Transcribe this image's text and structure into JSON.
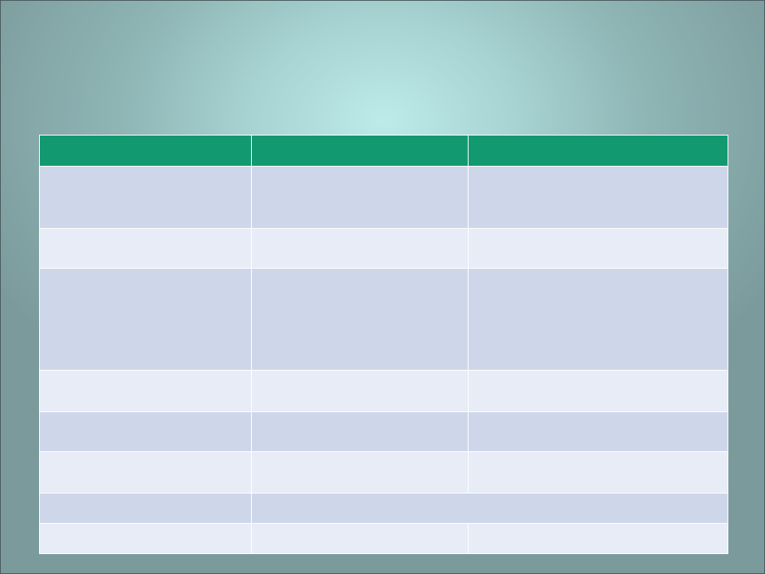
{
  "colors": {
    "header": "#12996f",
    "row_dark": "#ced7ea",
    "row_light": "#e8ecf6"
  },
  "table": {
    "headers": [
      "",
      "",
      ""
    ],
    "rows": [
      [
        "",
        "",
        ""
      ],
      [
        "",
        "",
        ""
      ],
      [
        "",
        "",
        ""
      ],
      [
        "",
        "",
        ""
      ],
      [
        "",
        "",
        ""
      ],
      [
        "",
        "",
        ""
      ],
      [
        "",
        ""
      ],
      [
        "",
        "",
        ""
      ]
    ]
  }
}
